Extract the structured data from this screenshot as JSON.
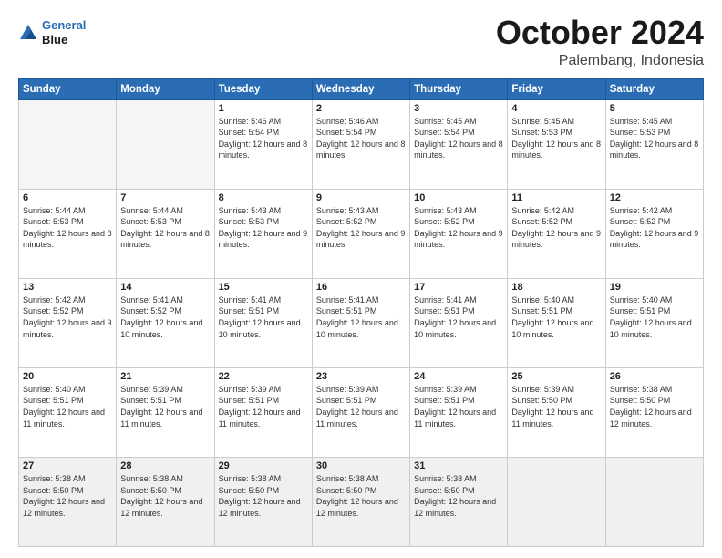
{
  "logo": {
    "line1": "General",
    "line2": "Blue"
  },
  "header": {
    "month": "October 2024",
    "location": "Palembang, Indonesia"
  },
  "weekdays": [
    "Sunday",
    "Monday",
    "Tuesday",
    "Wednesday",
    "Thursday",
    "Friday",
    "Saturday"
  ],
  "weeks": [
    [
      {
        "day": "",
        "info": ""
      },
      {
        "day": "",
        "info": ""
      },
      {
        "day": "1",
        "info": "Sunrise: 5:46 AM\nSunset: 5:54 PM\nDaylight: 12 hours and 8 minutes."
      },
      {
        "day": "2",
        "info": "Sunrise: 5:46 AM\nSunset: 5:54 PM\nDaylight: 12 hours and 8 minutes."
      },
      {
        "day": "3",
        "info": "Sunrise: 5:45 AM\nSunset: 5:54 PM\nDaylight: 12 hours and 8 minutes."
      },
      {
        "day": "4",
        "info": "Sunrise: 5:45 AM\nSunset: 5:53 PM\nDaylight: 12 hours and 8 minutes."
      },
      {
        "day": "5",
        "info": "Sunrise: 5:45 AM\nSunset: 5:53 PM\nDaylight: 12 hours and 8 minutes."
      }
    ],
    [
      {
        "day": "6",
        "info": "Sunrise: 5:44 AM\nSunset: 5:53 PM\nDaylight: 12 hours and 8 minutes."
      },
      {
        "day": "7",
        "info": "Sunrise: 5:44 AM\nSunset: 5:53 PM\nDaylight: 12 hours and 8 minutes."
      },
      {
        "day": "8",
        "info": "Sunrise: 5:43 AM\nSunset: 5:53 PM\nDaylight: 12 hours and 9 minutes."
      },
      {
        "day": "9",
        "info": "Sunrise: 5:43 AM\nSunset: 5:52 PM\nDaylight: 12 hours and 9 minutes."
      },
      {
        "day": "10",
        "info": "Sunrise: 5:43 AM\nSunset: 5:52 PM\nDaylight: 12 hours and 9 minutes."
      },
      {
        "day": "11",
        "info": "Sunrise: 5:42 AM\nSunset: 5:52 PM\nDaylight: 12 hours and 9 minutes."
      },
      {
        "day": "12",
        "info": "Sunrise: 5:42 AM\nSunset: 5:52 PM\nDaylight: 12 hours and 9 minutes."
      }
    ],
    [
      {
        "day": "13",
        "info": "Sunrise: 5:42 AM\nSunset: 5:52 PM\nDaylight: 12 hours and 9 minutes."
      },
      {
        "day": "14",
        "info": "Sunrise: 5:41 AM\nSunset: 5:52 PM\nDaylight: 12 hours and 10 minutes."
      },
      {
        "day": "15",
        "info": "Sunrise: 5:41 AM\nSunset: 5:51 PM\nDaylight: 12 hours and 10 minutes."
      },
      {
        "day": "16",
        "info": "Sunrise: 5:41 AM\nSunset: 5:51 PM\nDaylight: 12 hours and 10 minutes."
      },
      {
        "day": "17",
        "info": "Sunrise: 5:41 AM\nSunset: 5:51 PM\nDaylight: 12 hours and 10 minutes."
      },
      {
        "day": "18",
        "info": "Sunrise: 5:40 AM\nSunset: 5:51 PM\nDaylight: 12 hours and 10 minutes."
      },
      {
        "day": "19",
        "info": "Sunrise: 5:40 AM\nSunset: 5:51 PM\nDaylight: 12 hours and 10 minutes."
      }
    ],
    [
      {
        "day": "20",
        "info": "Sunrise: 5:40 AM\nSunset: 5:51 PM\nDaylight: 12 hours and 11 minutes."
      },
      {
        "day": "21",
        "info": "Sunrise: 5:39 AM\nSunset: 5:51 PM\nDaylight: 12 hours and 11 minutes."
      },
      {
        "day": "22",
        "info": "Sunrise: 5:39 AM\nSunset: 5:51 PM\nDaylight: 12 hours and 11 minutes."
      },
      {
        "day": "23",
        "info": "Sunrise: 5:39 AM\nSunset: 5:51 PM\nDaylight: 12 hours and 11 minutes."
      },
      {
        "day": "24",
        "info": "Sunrise: 5:39 AM\nSunset: 5:51 PM\nDaylight: 12 hours and 11 minutes."
      },
      {
        "day": "25",
        "info": "Sunrise: 5:39 AM\nSunset: 5:50 PM\nDaylight: 12 hours and 11 minutes."
      },
      {
        "day": "26",
        "info": "Sunrise: 5:38 AM\nSunset: 5:50 PM\nDaylight: 12 hours and 12 minutes."
      }
    ],
    [
      {
        "day": "27",
        "info": "Sunrise: 5:38 AM\nSunset: 5:50 PM\nDaylight: 12 hours and 12 minutes."
      },
      {
        "day": "28",
        "info": "Sunrise: 5:38 AM\nSunset: 5:50 PM\nDaylight: 12 hours and 12 minutes."
      },
      {
        "day": "29",
        "info": "Sunrise: 5:38 AM\nSunset: 5:50 PM\nDaylight: 12 hours and 12 minutes."
      },
      {
        "day": "30",
        "info": "Sunrise: 5:38 AM\nSunset: 5:50 PM\nDaylight: 12 hours and 12 minutes."
      },
      {
        "day": "31",
        "info": "Sunrise: 5:38 AM\nSunset: 5:50 PM\nDaylight: 12 hours and 12 minutes."
      },
      {
        "day": "",
        "info": ""
      },
      {
        "day": "",
        "info": ""
      }
    ]
  ]
}
